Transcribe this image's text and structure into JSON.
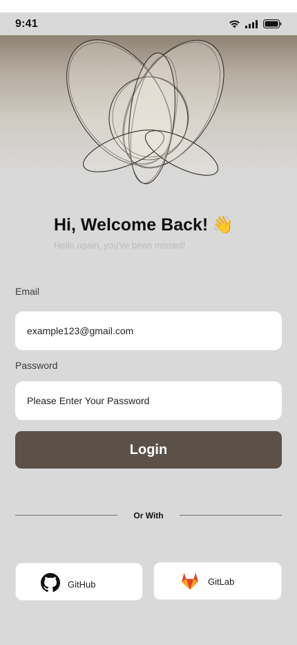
{
  "status_bar": {
    "time": "9:41"
  },
  "welcome": {
    "title": "Hi, Welcome Back!",
    "emoji": "👋",
    "subtitle": "Hello again, you've been missed!"
  },
  "form": {
    "email_label": "Email",
    "email_value": "example123@gmail.com",
    "password_label": "Password",
    "password_placeholder": "Please Enter Your Password",
    "login_label": "Login"
  },
  "divider": {
    "text": "Or With"
  },
  "social": {
    "github_label": "GitHub",
    "gitlab_label": "GitLab"
  },
  "colors": {
    "primary_button": "#5c5148",
    "background": "#d9d9d9",
    "gitlab_orange": "#fc6d26"
  }
}
